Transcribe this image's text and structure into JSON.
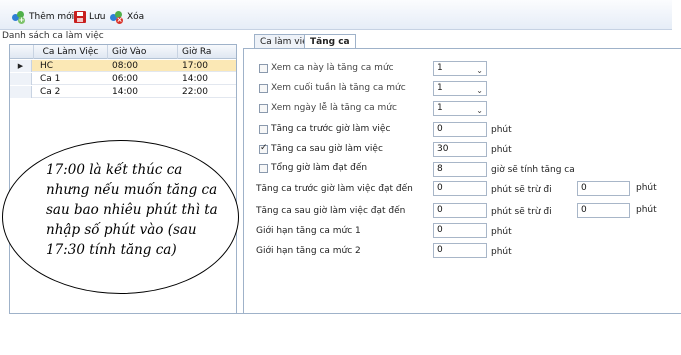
{
  "toolbar": {
    "add_label": "Thêm mới",
    "save_label": "Lưu",
    "delete_label": "Xóa"
  },
  "left": {
    "title": "Danh sách ca làm việc",
    "columns": [
      "Ca Làm Việc",
      "Giờ Vào",
      "Giờ Ra"
    ],
    "rows": [
      {
        "name": "HC",
        "in": "08:00",
        "out": "17:00",
        "selected": true
      },
      {
        "name": "Ca 1",
        "in": "06:00",
        "out": "14:00",
        "selected": false
      },
      {
        "name": "Ca 2",
        "in": "14:00",
        "out": "22:00",
        "selected": false
      }
    ]
  },
  "tabs": [
    "Ca làm việc",
    "Tăng ca"
  ],
  "form": {
    "xem_ca": {
      "label": "Xem ca này là tăng ca mức",
      "value": "1",
      "checked": false
    },
    "xem_cuoi_tuan": {
      "label": "Xem cuối tuần là tăng ca mức",
      "value": "1",
      "checked": false
    },
    "xem_ngay_le": {
      "label": "Xem ngày lễ là tăng ca mức",
      "value": "1",
      "checked": false
    },
    "truoc_gio": {
      "label": "Tăng ca trước giờ làm việc",
      "value": "0",
      "unit": "phút",
      "checked": false
    },
    "sau_gio": {
      "label": "Tăng ca sau giờ làm việc",
      "value": "30",
      "unit": "phút",
      "checked": true
    },
    "tong_gio": {
      "label": "Tổng giờ làm đạt đến",
      "value": "8",
      "unit": "giờ sẽ tính tăng ca",
      "checked": false
    },
    "truoc_dat_den": {
      "label": "Tăng ca trước giờ làm việc đạt đến",
      "value": "0",
      "unit": "phút sẽ trừ đi",
      "value2": "0",
      "unit2": "phút"
    },
    "sau_dat_den": {
      "label": "Tăng ca sau giờ làm việc đạt đến",
      "value": "0",
      "unit": "phút sẽ trừ đi",
      "value2": "0",
      "unit2": "phút"
    },
    "gioi_han_1": {
      "label": "Giới hạn tăng ca mức 1",
      "value": "0",
      "unit": "phút"
    },
    "gioi_han_2": {
      "label": "Giới hạn tăng ca mức 2",
      "value": "0",
      "unit": "phút"
    }
  },
  "callout": {
    "text": "17:00 là kết thúc ca nhưng nếu muốn tăng ca sau bao nhiêu phút thì ta nhập số phút vào (sau 17:30 tính tăng ca)"
  }
}
